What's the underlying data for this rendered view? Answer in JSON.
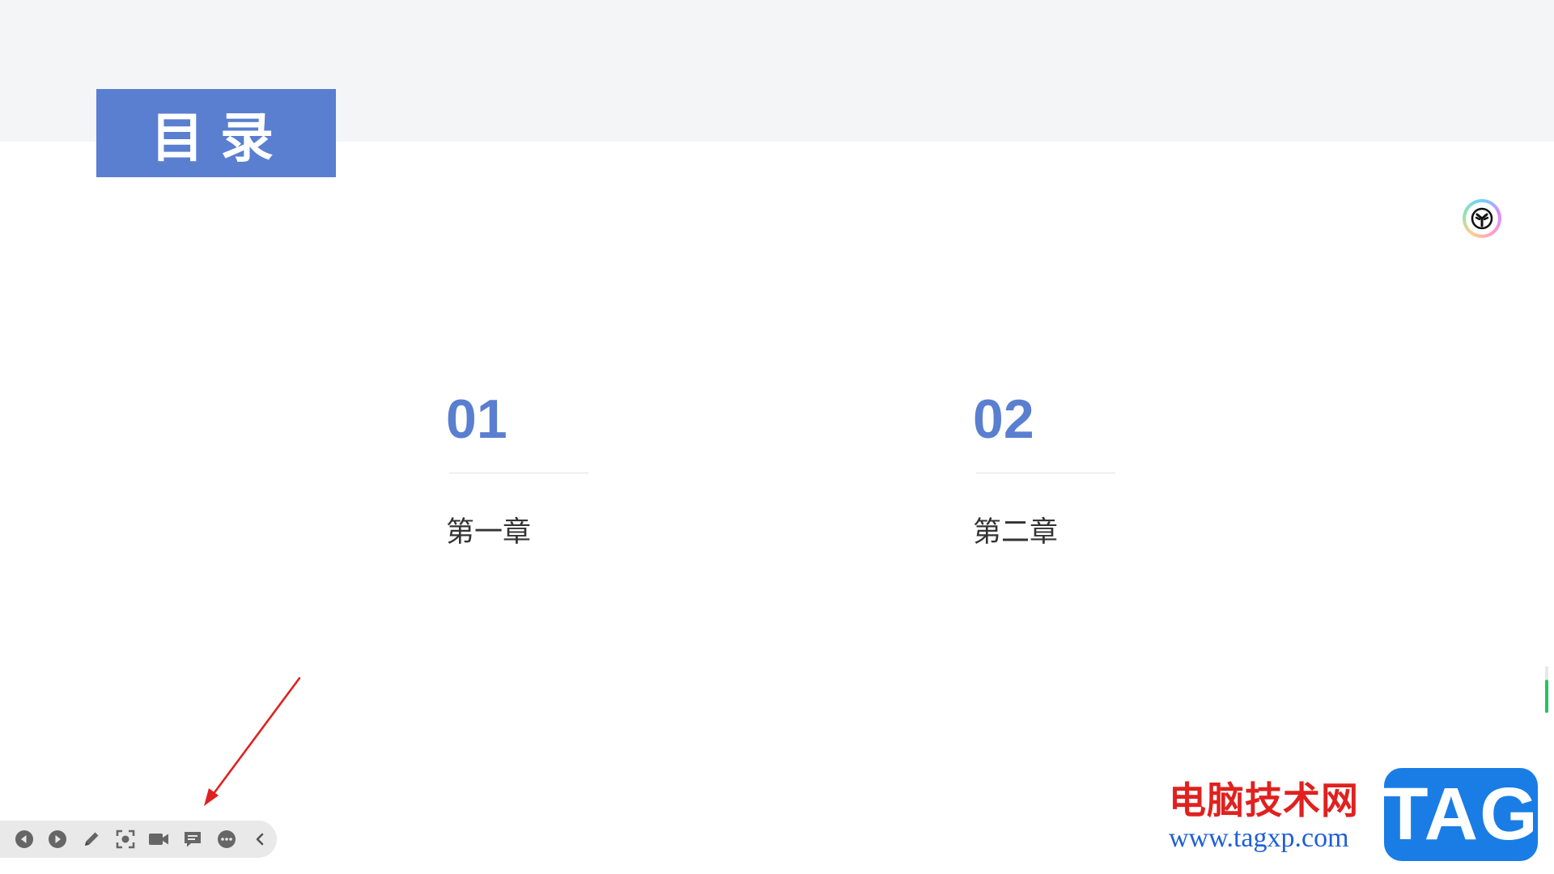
{
  "slide": {
    "title": "目录",
    "chapters": [
      {
        "number": "01",
        "label": "第一章"
      },
      {
        "number": "02",
        "label": "第二章"
      }
    ]
  },
  "ai_badge": {
    "icon": "ai-assistant-icon"
  },
  "scroll_indicator": {
    "progress": 0.7,
    "color": "#23c55e"
  },
  "annotation": {
    "icon": "red-arrow-icon",
    "color": "#e0211f"
  },
  "toolbar": {
    "buttons": [
      {
        "name": "previous-slide",
        "icon": "circle-left-icon"
      },
      {
        "name": "next-slide",
        "icon": "circle-right-icon"
      },
      {
        "name": "pen",
        "icon": "pen-icon"
      },
      {
        "name": "screenshot",
        "icon": "focus-frame-icon"
      },
      {
        "name": "record",
        "icon": "video-camera-icon"
      },
      {
        "name": "comment",
        "icon": "speech-bubble-icon"
      },
      {
        "name": "more",
        "icon": "more-dots-icon"
      },
      {
        "name": "collapse",
        "icon": "chevron-left-icon"
      }
    ]
  },
  "watermark": {
    "brand_cn": "电脑技术网",
    "url": "www.tagxp.com",
    "badge": "TAG"
  },
  "colors": {
    "accent": "#5a7fd0",
    "header_band": "#f4f5f7",
    "toolbar_bg": "#e9e9ea",
    "watermark_red": "#e0211f",
    "watermark_blue": "#1a7de6"
  }
}
